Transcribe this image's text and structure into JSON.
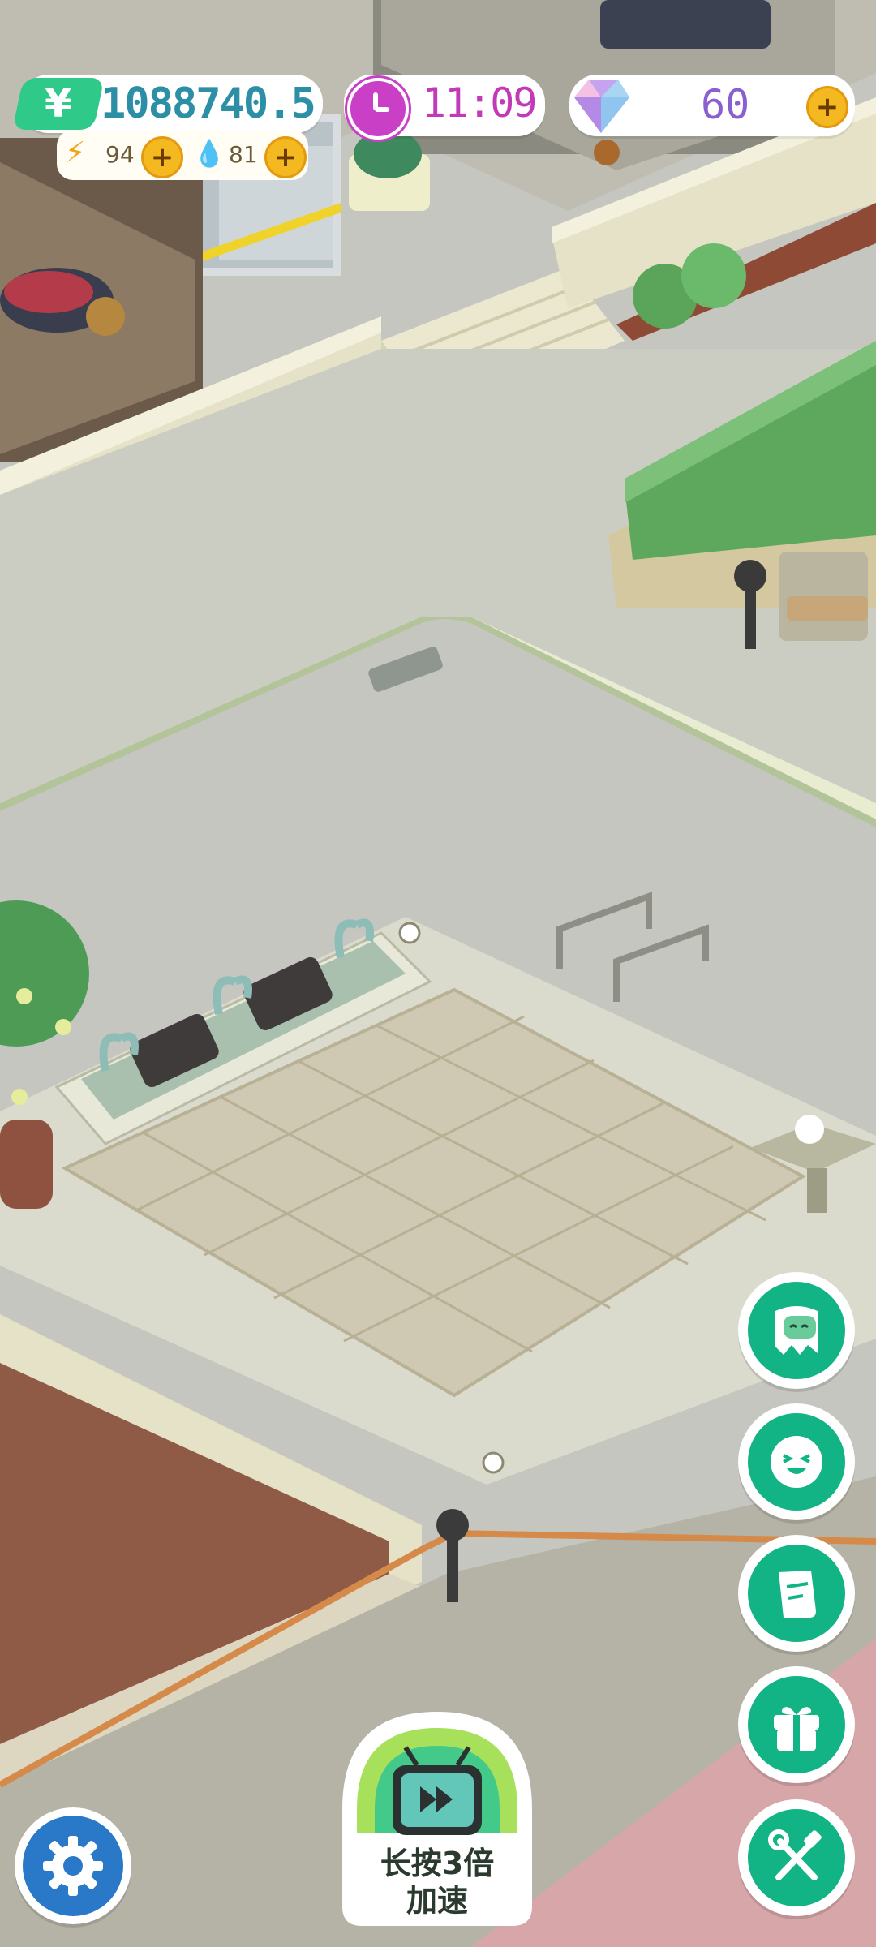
{
  "hud": {
    "money": "1088740.5",
    "money_icon": "yen-icon",
    "money_icon_glyph": "¥",
    "energy": "94",
    "water": "81",
    "time": "11:09",
    "gems": "60"
  },
  "buttons": {
    "speed_label_line1": "长按3倍",
    "speed_label_line2": "加速",
    "plus_glyph": "+"
  },
  "side_buttons": [
    "ghost-friend-icon",
    "smiley-face-icon",
    "notes-icon",
    "gift-icon",
    "build-tools-icon"
  ],
  "colors": {
    "accent_green": "#12b384",
    "money_text": "#2d8fa6",
    "time_text": "#c33ab8",
    "gem_text": "#8a5fcf",
    "settings_blue": "#2a78c8"
  }
}
